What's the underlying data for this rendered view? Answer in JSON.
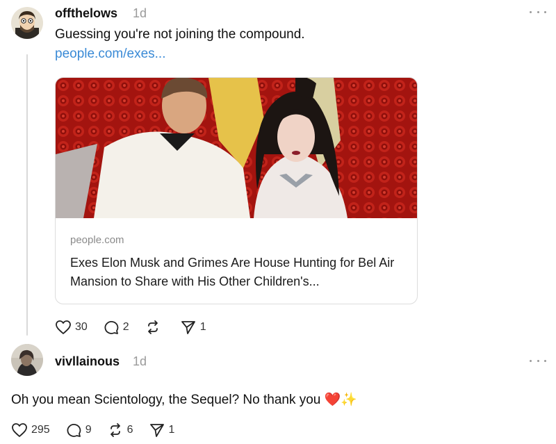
{
  "post1": {
    "username": "offthelows",
    "time": "1d",
    "text": "Guessing you're not joining the compound.",
    "link": "people.com/exes...",
    "card": {
      "domain": "people.com",
      "title": "Exes Elon Musk and Grimes Are House Hunting for Bel Air Mansion to Share with His Other Children's..."
    },
    "actions": {
      "likes": "30",
      "replies": "2",
      "reposts": "",
      "shares": "1"
    }
  },
  "post2": {
    "username": "vivllainous",
    "time": "1d",
    "text": "Oh you mean Scientology, the Sequel? No thank you",
    "emoji": "❤️✨",
    "actions": {
      "likes": "295",
      "replies": "9",
      "reposts": "6",
      "shares": "1"
    }
  },
  "colors": {
    "link": "#3a8ad6",
    "muted": "#9a9a9a",
    "thread": "#d9d9d9"
  },
  "icons": [
    "heart-icon",
    "comment-icon",
    "repost-icon",
    "send-icon",
    "more-icon"
  ]
}
